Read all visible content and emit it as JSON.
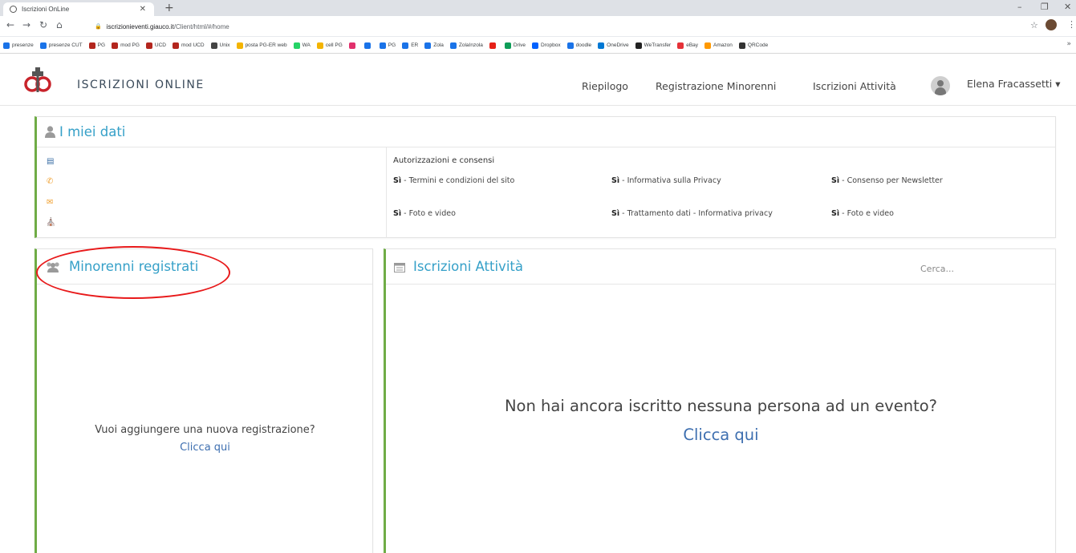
{
  "browser": {
    "tab_title": "Iscrizioni OnLine",
    "url_host": "iscrizionieventi.giauco.it",
    "url_path": "/Client/html/#/home",
    "bookmarks": [
      {
        "label": "presenze",
        "color": "#1a73e8"
      },
      {
        "label": "presenze CUT",
        "color": "#1a73e8"
      },
      {
        "label": "PG",
        "color": "#b3261e"
      },
      {
        "label": "mod PG",
        "color": "#b3261e"
      },
      {
        "label": "UCD",
        "color": "#b3261e"
      },
      {
        "label": "mod UCD",
        "color": "#b3261e"
      },
      {
        "label": "Unix",
        "color": "#444444"
      },
      {
        "label": "posta PG-ER web",
        "color": "#f4b400"
      },
      {
        "label": "WA",
        "color": "#25d366"
      },
      {
        "label": "cell PG",
        "color": "#f4b400"
      },
      {
        "label": "",
        "color": "#e1306c"
      },
      {
        "label": "",
        "color": "#1a73e8"
      },
      {
        "label": "PG",
        "color": "#1a73e8"
      },
      {
        "label": "ER",
        "color": "#1a73e8"
      },
      {
        "label": "Zola",
        "color": "#1a73e8"
      },
      {
        "label": "ZolaInzola",
        "color": "#1a73e8"
      },
      {
        "label": "",
        "color": "#e62117"
      },
      {
        "label": "Drive",
        "color": "#0f9d58"
      },
      {
        "label": "Dropbox",
        "color": "#0061ff"
      },
      {
        "label": "doodle",
        "color": "#1a73e8"
      },
      {
        "label": "OneDrive",
        "color": "#0078d4"
      },
      {
        "label": "WeTransfer",
        "color": "#222222"
      },
      {
        "label": "eBay",
        "color": "#e53238"
      },
      {
        "label": "Amazon",
        "color": "#ff9900"
      },
      {
        "label": "QRCode",
        "color": "#333333"
      }
    ]
  },
  "header": {
    "app_title": "ISCRIZIONI ONLINE",
    "nav": [
      "Riepilogo",
      "Registrazione Minorenni",
      "Iscrizioni Attività"
    ],
    "user_name": "Elena Fracassetti ▾"
  },
  "dati": {
    "title": "I miei dati",
    "auth_title": "Autorizzazioni e consensi",
    "consents": [
      {
        "value": "Sì",
        "label": " - Termini e condizioni del sito"
      },
      {
        "value": "Sì",
        "label": " - Informativa sulla Privacy"
      },
      {
        "value": "Sì",
        "label": " - Consenso per Newsletter"
      },
      {
        "value": "Sì",
        "label": " - Foto e video"
      },
      {
        "value": "Sì",
        "label": " - Trattamento dati - Informativa privacy"
      },
      {
        "value": "Sì",
        "label": " - Foto e video"
      }
    ]
  },
  "minori": {
    "title": "Minorenni registrati",
    "empty_message": "Vuoi aggiungere una nuova registrazione?",
    "link": "Clicca qui"
  },
  "attivita": {
    "title": "Iscrizioni Attività",
    "search_placeholder": "Cerca...",
    "empty_message": "Non hai ancora iscritto nessuna persona ad un evento?",
    "link": "Clicca qui"
  },
  "colors": {
    "accent_green": "#6fac46",
    "title_blue": "#35a0c8",
    "link_blue": "#3e6fb0",
    "annotation_red": "#e8191a"
  }
}
